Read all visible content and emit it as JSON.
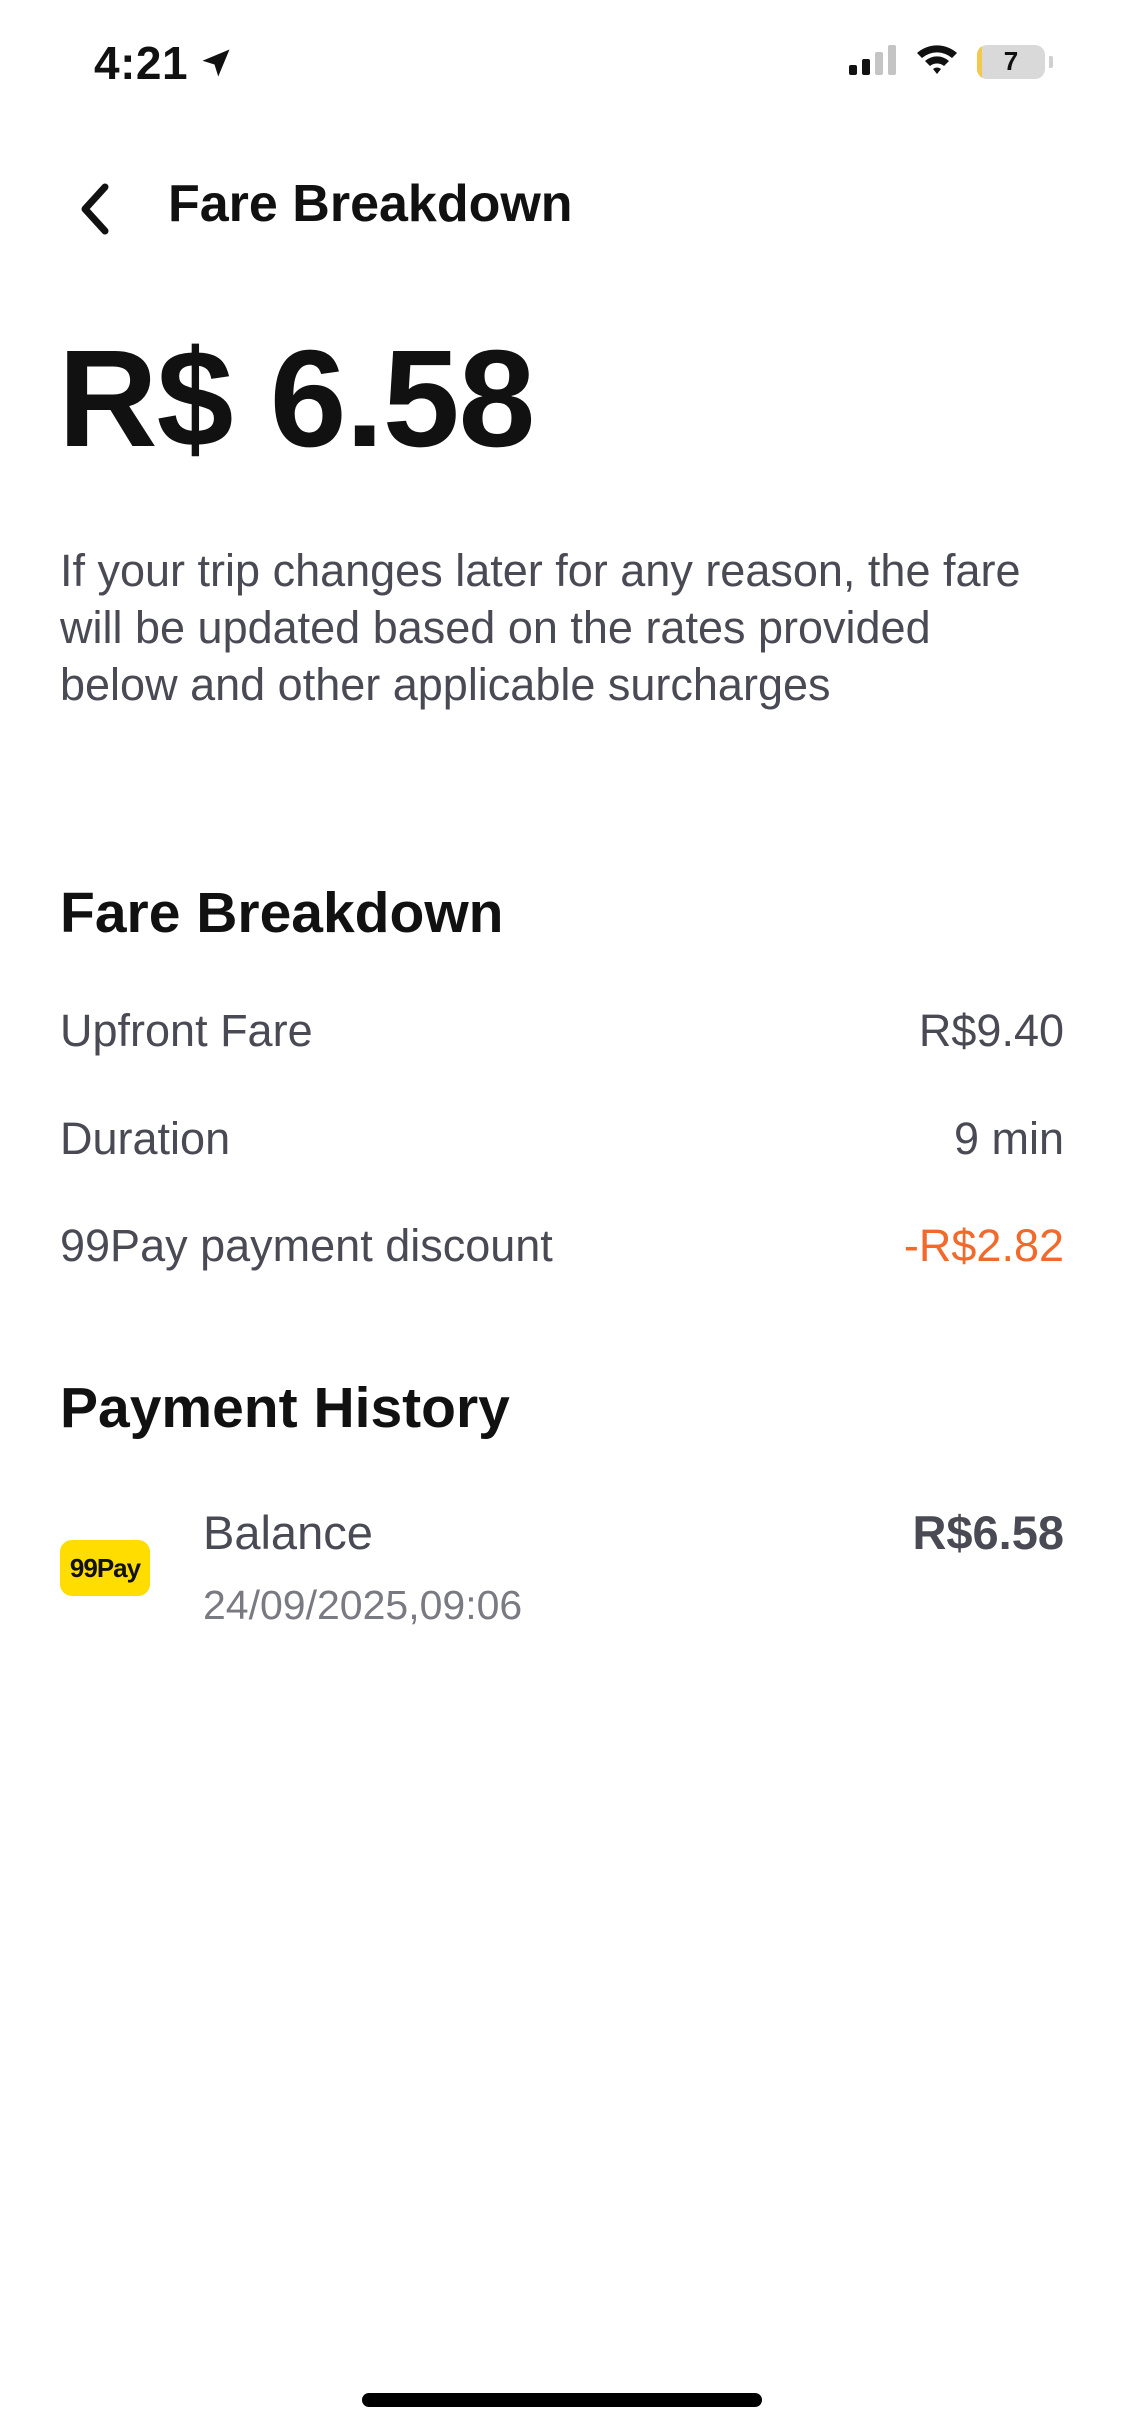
{
  "status_bar": {
    "time": "4:21",
    "battery_level": "7",
    "battery_percent": 7,
    "battery_color": "#f2c94c",
    "icons": [
      "location-arrow-icon",
      "cellular-signal-icon",
      "wifi-icon",
      "battery-icon"
    ]
  },
  "header": {
    "title": "Fare Breakdown",
    "back_icon": "chevron-left-icon"
  },
  "total": {
    "amount": "R$ 6.58"
  },
  "disclaimer": "If your trip changes later for any reason, the fare will be updated based on the rates provided below and other applicable surcharges",
  "fare_breakdown": {
    "title": "Fare Breakdown",
    "rows": [
      {
        "label": "Upfront Fare",
        "value": "R$9.40"
      },
      {
        "label": "Duration",
        "value": "9 min"
      },
      {
        "label": "99Pay payment discount",
        "value": "-R$2.82",
        "value_color": "#f26a2b"
      }
    ]
  },
  "payment_history": {
    "title": "Payment History",
    "items": [
      {
        "logo_text": "99Pay",
        "logo_color": "#ffdd00",
        "label": "Balance",
        "datetime": "24/09/2025,09:06",
        "amount": "R$6.58"
      }
    ]
  }
}
